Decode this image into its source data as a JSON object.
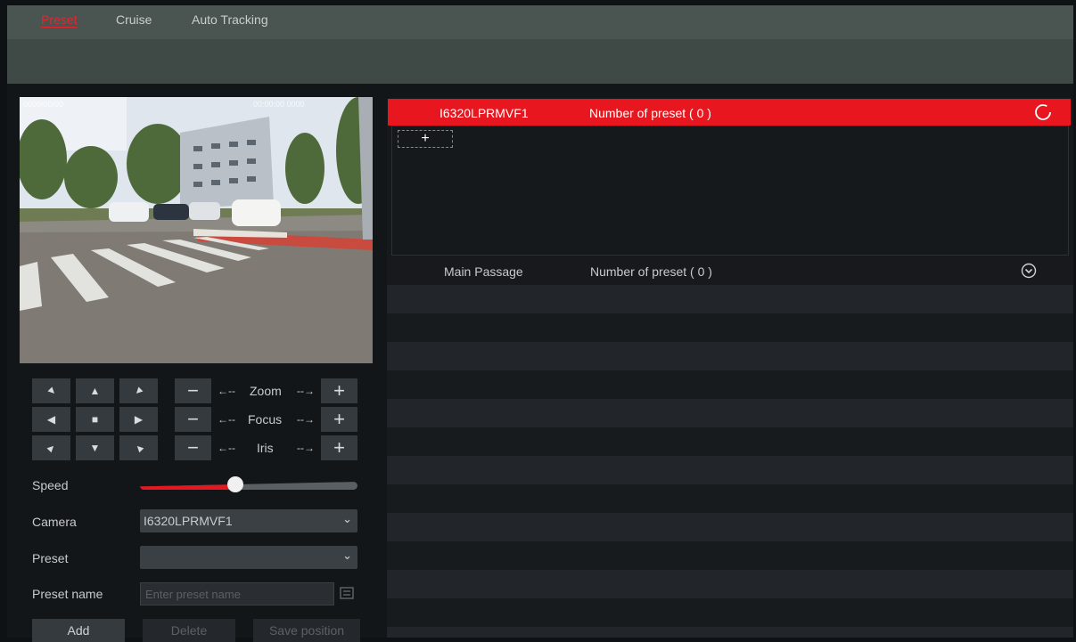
{
  "tabs": [
    {
      "label": "Preset",
      "active": true
    },
    {
      "label": "Cruise",
      "active": false
    },
    {
      "label": "Auto Tracking",
      "active": false
    }
  ],
  "video": {
    "overlay_left": "0000/00/00",
    "overlay_right": "00:00:00  0000"
  },
  "ptz": {
    "buttons": [
      "up-left",
      "up",
      "up-right",
      "left",
      "stop",
      "right",
      "down-left",
      "down",
      "down-right"
    ],
    "controls": [
      {
        "label": "Zoom",
        "minus": "−",
        "plus": "+",
        "arrow_left": "←--",
        "arrow_right": "--→"
      },
      {
        "label": "Focus",
        "minus": "−",
        "plus": "+",
        "arrow_left": "←--",
        "arrow_right": "--→"
      },
      {
        "label": "Iris",
        "minus": "−",
        "plus": "+",
        "arrow_left": "←--",
        "arrow_right": "--→"
      }
    ]
  },
  "form": {
    "speed_label": "Speed",
    "speed_value": 0.44,
    "camera_label": "Camera",
    "camera_value": "I6320LPRMVF1",
    "preset_label": "Preset",
    "preset_value": "",
    "preset_name_label": "Preset name",
    "preset_name_placeholder": "Enter preset name",
    "add_label": "Add",
    "delete_label": "Delete",
    "save_position_label": "Save position"
  },
  "groups": [
    {
      "name": "I6320LPRMVF1",
      "count_text": "Number of preset ( 0 )",
      "expanded": true,
      "add_symbol": "+"
    },
    {
      "name": "Main Passage",
      "count_text": "Number of preset ( 0 )",
      "expanded": false
    }
  ],
  "colors": {
    "accent": "#e8161e",
    "panel": "#16191c",
    "button": "#353a3f"
  }
}
